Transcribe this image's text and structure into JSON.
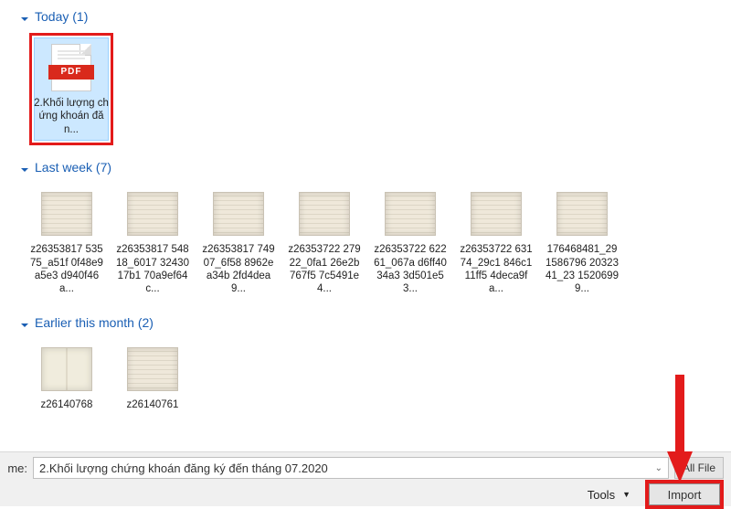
{
  "groups": [
    {
      "label": "Today (1)",
      "items": [
        {
          "type": "pdf",
          "label": "2.Khối lượng chứng khoán đăn...",
          "selected": true,
          "highlighted": true
        }
      ]
    },
    {
      "label": "Last week (7)",
      "items": [
        {
          "type": "img",
          "label": "z26353817 53575_a51f 0f48e9a5e3 d940f46a..."
        },
        {
          "type": "img",
          "label": "z26353817 54818_6017 3243017b1 70a9ef64c..."
        },
        {
          "type": "img",
          "label": "z26353817 74907_6f58 8962ea34b 2fd4dea9..."
        },
        {
          "type": "img",
          "label": "z26353722 27922_0fa1 26e2b767f5 7c5491e4..."
        },
        {
          "type": "img",
          "label": "z26353722 62261_067a d6ff4034a3 3d501e53..."
        },
        {
          "type": "img",
          "label": "z26353722 63174_29c1 846c111ff5 4deca9fa..."
        },
        {
          "type": "img",
          "label": "176468481_291586796 2032341_23 15206999..."
        }
      ]
    },
    {
      "label": "Earlier this month (2)",
      "items": [
        {
          "type": "book",
          "label": "z26140768"
        },
        {
          "type": "img",
          "label": "z26140761"
        }
      ]
    }
  ],
  "bottom": {
    "me_label": "me:",
    "filename": "2.Khối lượng chứng khoán đăng ký đến tháng 07.2020",
    "filter": "All File",
    "tools_label": "Tools",
    "import_label": "Import"
  },
  "pdf_band": "PDF"
}
